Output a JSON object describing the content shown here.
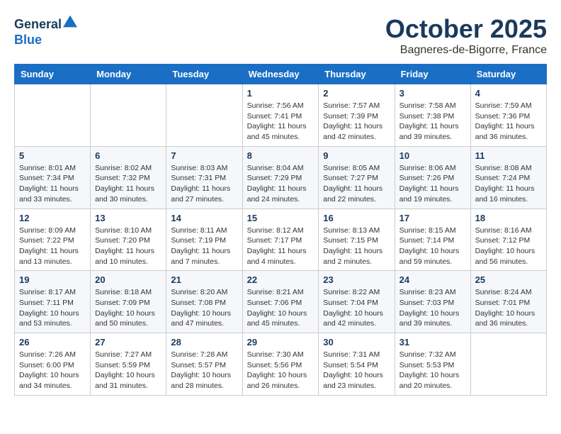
{
  "header": {
    "logo_line1": "General",
    "logo_line2": "Blue",
    "month_title": "October 2025",
    "location": "Bagneres-de-Bigorre, France"
  },
  "weekdays": [
    "Sunday",
    "Monday",
    "Tuesday",
    "Wednesday",
    "Thursday",
    "Friday",
    "Saturday"
  ],
  "weeks": [
    [
      {
        "day": "",
        "info": ""
      },
      {
        "day": "",
        "info": ""
      },
      {
        "day": "",
        "info": ""
      },
      {
        "day": "1",
        "info": "Sunrise: 7:56 AM\nSunset: 7:41 PM\nDaylight: 11 hours\nand 45 minutes."
      },
      {
        "day": "2",
        "info": "Sunrise: 7:57 AM\nSunset: 7:39 PM\nDaylight: 11 hours\nand 42 minutes."
      },
      {
        "day": "3",
        "info": "Sunrise: 7:58 AM\nSunset: 7:38 PM\nDaylight: 11 hours\nand 39 minutes."
      },
      {
        "day": "4",
        "info": "Sunrise: 7:59 AM\nSunset: 7:36 PM\nDaylight: 11 hours\nand 36 minutes."
      }
    ],
    [
      {
        "day": "5",
        "info": "Sunrise: 8:01 AM\nSunset: 7:34 PM\nDaylight: 11 hours\nand 33 minutes."
      },
      {
        "day": "6",
        "info": "Sunrise: 8:02 AM\nSunset: 7:32 PM\nDaylight: 11 hours\nand 30 minutes."
      },
      {
        "day": "7",
        "info": "Sunrise: 8:03 AM\nSunset: 7:31 PM\nDaylight: 11 hours\nand 27 minutes."
      },
      {
        "day": "8",
        "info": "Sunrise: 8:04 AM\nSunset: 7:29 PM\nDaylight: 11 hours\nand 24 minutes."
      },
      {
        "day": "9",
        "info": "Sunrise: 8:05 AM\nSunset: 7:27 PM\nDaylight: 11 hours\nand 22 minutes."
      },
      {
        "day": "10",
        "info": "Sunrise: 8:06 AM\nSunset: 7:26 PM\nDaylight: 11 hours\nand 19 minutes."
      },
      {
        "day": "11",
        "info": "Sunrise: 8:08 AM\nSunset: 7:24 PM\nDaylight: 11 hours\nand 16 minutes."
      }
    ],
    [
      {
        "day": "12",
        "info": "Sunrise: 8:09 AM\nSunset: 7:22 PM\nDaylight: 11 hours\nand 13 minutes."
      },
      {
        "day": "13",
        "info": "Sunrise: 8:10 AM\nSunset: 7:20 PM\nDaylight: 11 hours\nand 10 minutes."
      },
      {
        "day": "14",
        "info": "Sunrise: 8:11 AM\nSunset: 7:19 PM\nDaylight: 11 hours\nand 7 minutes."
      },
      {
        "day": "15",
        "info": "Sunrise: 8:12 AM\nSunset: 7:17 PM\nDaylight: 11 hours\nand 4 minutes."
      },
      {
        "day": "16",
        "info": "Sunrise: 8:13 AM\nSunset: 7:15 PM\nDaylight: 11 hours\nand 2 minutes."
      },
      {
        "day": "17",
        "info": "Sunrise: 8:15 AM\nSunset: 7:14 PM\nDaylight: 10 hours\nand 59 minutes."
      },
      {
        "day": "18",
        "info": "Sunrise: 8:16 AM\nSunset: 7:12 PM\nDaylight: 10 hours\nand 56 minutes."
      }
    ],
    [
      {
        "day": "19",
        "info": "Sunrise: 8:17 AM\nSunset: 7:11 PM\nDaylight: 10 hours\nand 53 minutes."
      },
      {
        "day": "20",
        "info": "Sunrise: 8:18 AM\nSunset: 7:09 PM\nDaylight: 10 hours\nand 50 minutes."
      },
      {
        "day": "21",
        "info": "Sunrise: 8:20 AM\nSunset: 7:08 PM\nDaylight: 10 hours\nand 47 minutes."
      },
      {
        "day": "22",
        "info": "Sunrise: 8:21 AM\nSunset: 7:06 PM\nDaylight: 10 hours\nand 45 minutes."
      },
      {
        "day": "23",
        "info": "Sunrise: 8:22 AM\nSunset: 7:04 PM\nDaylight: 10 hours\nand 42 minutes."
      },
      {
        "day": "24",
        "info": "Sunrise: 8:23 AM\nSunset: 7:03 PM\nDaylight: 10 hours\nand 39 minutes."
      },
      {
        "day": "25",
        "info": "Sunrise: 8:24 AM\nSunset: 7:01 PM\nDaylight: 10 hours\nand 36 minutes."
      }
    ],
    [
      {
        "day": "26",
        "info": "Sunrise: 7:26 AM\nSunset: 6:00 PM\nDaylight: 10 hours\nand 34 minutes."
      },
      {
        "day": "27",
        "info": "Sunrise: 7:27 AM\nSunset: 5:59 PM\nDaylight: 10 hours\nand 31 minutes."
      },
      {
        "day": "28",
        "info": "Sunrise: 7:28 AM\nSunset: 5:57 PM\nDaylight: 10 hours\nand 28 minutes."
      },
      {
        "day": "29",
        "info": "Sunrise: 7:30 AM\nSunset: 5:56 PM\nDaylight: 10 hours\nand 26 minutes."
      },
      {
        "day": "30",
        "info": "Sunrise: 7:31 AM\nSunset: 5:54 PM\nDaylight: 10 hours\nand 23 minutes."
      },
      {
        "day": "31",
        "info": "Sunrise: 7:32 AM\nSunset: 5:53 PM\nDaylight: 10 hours\nand 20 minutes."
      },
      {
        "day": "",
        "info": ""
      }
    ]
  ]
}
